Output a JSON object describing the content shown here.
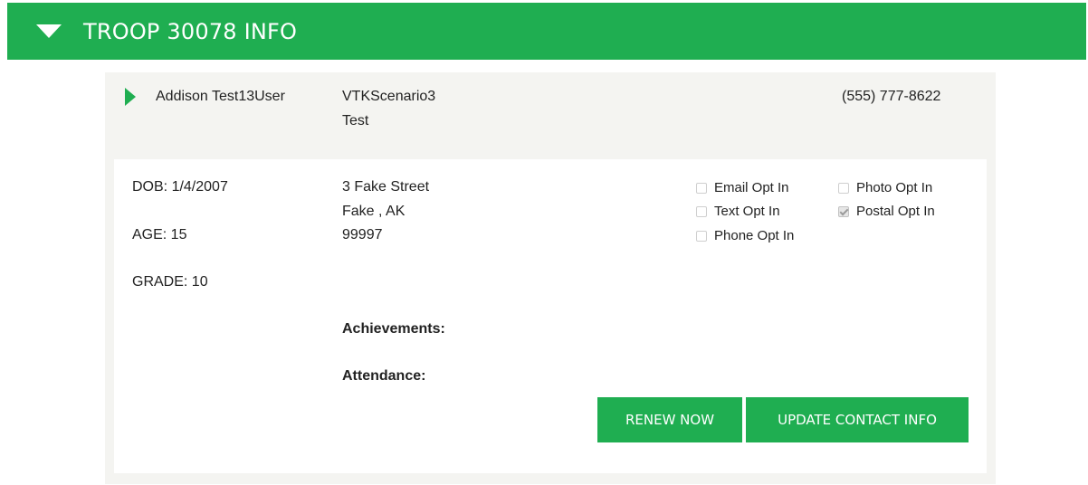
{
  "troop": {
    "title": "TROOP 30078 INFO"
  },
  "member": {
    "name": "Addison Test13User",
    "scenario_line1": "VTKScenario3",
    "scenario_line2": "Test",
    "phone": "(555) 777-8622"
  },
  "details": {
    "dob": "DOB: 1/4/2007",
    "age": "AGE: 15",
    "grade": "GRADE: 10",
    "address_line1": "3 Fake Street",
    "address_line2": "Fake , AK",
    "address_line3": "99997",
    "achievements_label": "Achievements:",
    "attendance_label": "Attendance:"
  },
  "opt_ins": {
    "email": {
      "label": "Email Opt In",
      "checked": false
    },
    "text": {
      "label": "Text Opt In",
      "checked": false
    },
    "phone": {
      "label": "Phone Opt In",
      "checked": false
    },
    "photo": {
      "label": "Photo Opt In",
      "checked": false
    },
    "postal": {
      "label": "Postal Opt In",
      "checked": true
    }
  },
  "actions": {
    "renew_label": "RENEW NOW",
    "update_contact_label": "UPDATE CONTACT INFO"
  },
  "colors": {
    "accent_green": "#1fae51",
    "panel_bg": "#f4f4f1",
    "text": "#222222"
  },
  "icons": {
    "troop_toggle": "caret-down-icon",
    "member_toggle": "caret-right-icon"
  }
}
